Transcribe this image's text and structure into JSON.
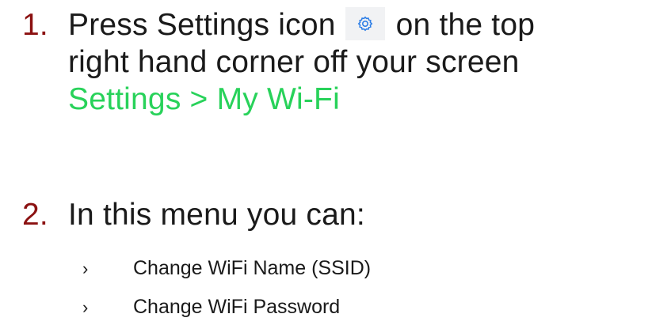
{
  "steps": [
    {
      "number": "1.",
      "text_before_icon": "Press Settings icon",
      "icon": "gear-icon",
      "text_after_icon": "on the top",
      "line2": "right hand corner off your screen",
      "path": "Settings > My Wi-Fi"
    },
    {
      "number": "2.",
      "text": "In this menu you can:",
      "bullets": [
        {
          "marker": "›",
          "label": "Change WiFi Name (SSID)"
        },
        {
          "marker": "›",
          "label": "Change WiFi Password"
        }
      ]
    }
  ],
  "colors": {
    "number": "#8b1111",
    "path": "#28d25a",
    "icon": "#2f7fe6",
    "icon_background": "#f1f2f4"
  }
}
